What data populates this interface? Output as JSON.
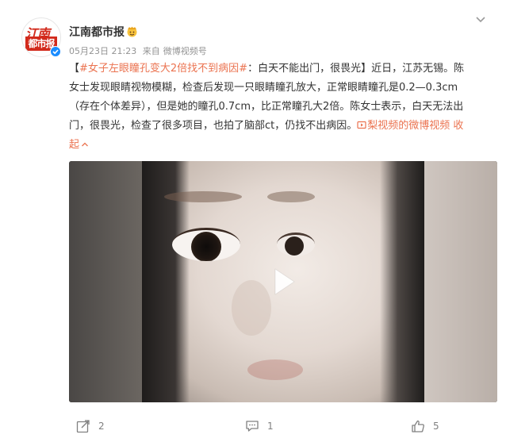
{
  "post": {
    "author": {
      "name": "江南都市报",
      "avatar_text_line1": "江南",
      "avatar_text_line2": "都市报",
      "verified": true,
      "vip_icon": "vip-emoji-icon"
    },
    "meta": {
      "date": "05月23日 21:23",
      "source_prefix": "来自",
      "source": "微博视频号"
    },
    "text": {
      "line1_prefix": "【",
      "hashtag": "#女子左眼瞳孔变大2倍找不到病因#",
      "line1_rest": "：白天不能出门，很畏光】近日，江苏无锡。陈",
      "line2": "女士发现眼睛视物模糊，检查后发现一只眼睛瞳孔放大，正常眼睛瞳孔是0.2—0.3cm",
      "line3": "（存在个体差异），但是她的瞳孔0.7cm，比正常瞳孔大2倍。陈女士表示，白天无法出",
      "line4_main": "门，很畏光，检查了很多项目，也拍了脑部ct，仍找不出病因。",
      "video_link": "梨视频的微博视频",
      "collapse_a": "收",
      "collapse_b": "起"
    },
    "video": {
      "play_icon": "play-icon"
    },
    "actions": {
      "share_count": "2",
      "comment_count": "1",
      "like_count": "5"
    }
  },
  "colors": {
    "accent": "#eb7350",
    "text": "#333333",
    "meta": "#939393",
    "verify": "#1a8cff"
  }
}
